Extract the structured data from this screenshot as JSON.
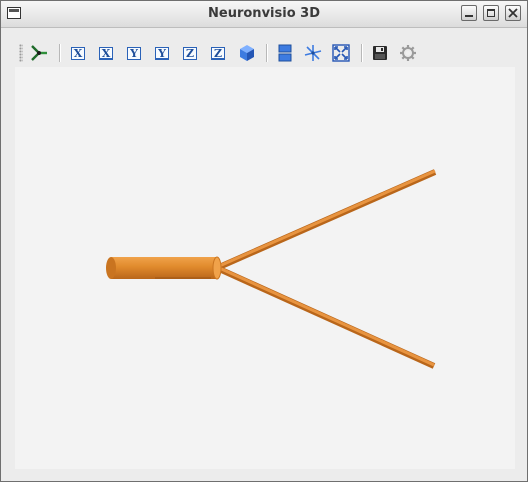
{
  "window": {
    "title": "Neuronvisio 3D"
  },
  "toolbar": {
    "buttons": [
      {
        "name": "select-tool",
        "icon": "pointer-tripod-icon"
      },
      {
        "name": "view-x",
        "label": "X",
        "icon": "axis-x-icon"
      },
      {
        "name": "view-x-opposite",
        "label": "X",
        "icon": "axis-x-opposite-icon"
      },
      {
        "name": "view-y",
        "label": "Y",
        "icon": "axis-y-icon"
      },
      {
        "name": "view-y-opposite",
        "label": "Y",
        "icon": "axis-y-opposite-icon"
      },
      {
        "name": "view-z",
        "label": "Z",
        "icon": "axis-z-icon"
      },
      {
        "name": "view-z-opposite",
        "label": "Z",
        "icon": "axis-z-opposite-icon"
      },
      {
        "name": "isometric-view",
        "icon": "cube-icon"
      },
      {
        "name": "toggle-panel",
        "icon": "split-panel-icon"
      },
      {
        "name": "center-view",
        "icon": "axes-star-icon"
      },
      {
        "name": "fit-all",
        "icon": "fit-view-icon"
      },
      {
        "name": "save",
        "icon": "floppy-disk-icon"
      },
      {
        "name": "settings",
        "icon": "gear-icon"
      }
    ]
  },
  "scene": {
    "background": "#f3f3f3",
    "neurite_color": "#e08a2c",
    "neurite_shadow": "#b9661a"
  },
  "colors": {
    "axis_icon_blue": "#2a62b8",
    "cube_blue": "#3d7be0",
    "titlebar_text": "#3a3a3a"
  }
}
